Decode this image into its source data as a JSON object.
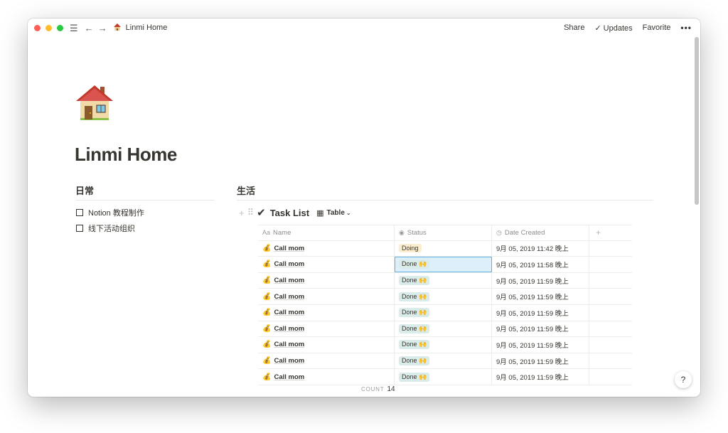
{
  "titlebar": {
    "page_title": "Linmi Home",
    "share_label": "Share",
    "updates_label": "Updates",
    "favorite_label": "Favorite",
    "more_label": "•••"
  },
  "page": {
    "icon": "house-icon",
    "title": "Linmi Home"
  },
  "left_column": {
    "heading": "日常",
    "todos": [
      {
        "label": "Notion 教程制作",
        "checked": false
      },
      {
        "label": "线下活动组织",
        "checked": false
      }
    ]
  },
  "right_column": {
    "heading": "生活",
    "database": {
      "title": "Task List",
      "view_label": "Table",
      "columns": [
        {
          "label": "Name",
          "icon": "text-property-icon"
        },
        {
          "label": "Status",
          "icon": "select-property-icon"
        },
        {
          "label": "Date Created",
          "icon": "clock-icon"
        }
      ],
      "rows": [
        {
          "name": "Call mom",
          "status": "Doing",
          "status_kind": "doing",
          "date": "9月 05, 2019 11:42 晚上"
        },
        {
          "name": "Call mom",
          "status": "Done 🙌",
          "status_kind": "done",
          "date": "9月 05, 2019 11:58 晚上",
          "selected": true
        },
        {
          "name": "Call mom",
          "status": "Done 🙌",
          "status_kind": "done",
          "date": "9月 05, 2019 11:59 晚上"
        },
        {
          "name": "Call mom",
          "status": "Done 🙌",
          "status_kind": "done",
          "date": "9月 05, 2019 11:59 晚上"
        },
        {
          "name": "Call mom",
          "status": "Done 🙌",
          "status_kind": "done",
          "date": "9月 05, 2019 11:59 晚上"
        },
        {
          "name": "Call mom",
          "status": "Done 🙌",
          "status_kind": "done",
          "date": "9月 05, 2019 11:59 晚上"
        },
        {
          "name": "Call mom",
          "status": "Done 🙌",
          "status_kind": "done",
          "date": "9月 05, 2019 11:59 晚上"
        },
        {
          "name": "Call mom",
          "status": "Done 🙌",
          "status_kind": "done",
          "date": "9月 05, 2019 11:59 晚上"
        },
        {
          "name": "Call mom",
          "status": "Done 🙌",
          "status_kind": "done",
          "date": "9月 05, 2019 11:59 晚上"
        }
      ],
      "row_icon": "money-bag-icon",
      "count_label": "COUNT",
      "count_value": "14"
    }
  },
  "help_label": "?",
  "colors": {
    "doing_tag": "#fbeecf",
    "done_tag": "#d9ece9",
    "selection": "#ddeffa"
  }
}
